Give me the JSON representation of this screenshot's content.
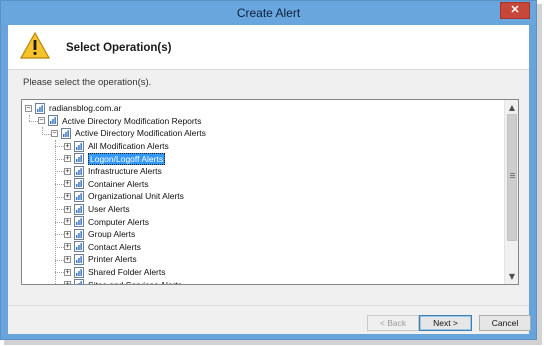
{
  "window": {
    "title": "Create Alert",
    "close_glyph": "✕"
  },
  "header": {
    "title": "Select Operation(s)",
    "icon": "warning-icon"
  },
  "instruction": "Please select the operation(s).",
  "tree": {
    "items": [
      {
        "label": "radiansblog.com.ar",
        "level": 0,
        "expander": "−"
      },
      {
        "label": "Active Directory Modification Reports",
        "level": 1,
        "expander": "−"
      },
      {
        "label": "Active Directory Modification Alerts",
        "level": 2,
        "expander": "−"
      },
      {
        "label": "All Modification Alerts",
        "level": 3,
        "expander": "+"
      },
      {
        "label": "Logon/Logoff Alerts",
        "level": 3,
        "expander": "+",
        "selected": true
      },
      {
        "label": "Infrastructure Alerts",
        "level": 3,
        "expander": "+"
      },
      {
        "label": "Container Alerts",
        "level": 3,
        "expander": "+"
      },
      {
        "label": "Organizational Unit Alerts",
        "level": 3,
        "expander": "+"
      },
      {
        "label": "User Alerts",
        "level": 3,
        "expander": "+"
      },
      {
        "label": "Computer Alerts",
        "level": 3,
        "expander": "+"
      },
      {
        "label": "Group Alerts",
        "level": 3,
        "expander": "+"
      },
      {
        "label": "Contact Alerts",
        "level": 3,
        "expander": "+"
      },
      {
        "label": "Printer Alerts",
        "level": 3,
        "expander": "+"
      },
      {
        "label": "Shared Folder Alerts",
        "level": 3,
        "expander": "+"
      },
      {
        "label": "Sites and Services Alerts",
        "level": 3,
        "expander": "+"
      }
    ]
  },
  "scrollbar": {
    "up_glyph": "▲",
    "down_glyph": "▼"
  },
  "buttons": {
    "back": "< Back",
    "next": "Next >",
    "cancel": "Cancel"
  },
  "colors": {
    "titlebar": "#6aa6de",
    "selection": "#3399ff",
    "close": "#c7483b"
  }
}
